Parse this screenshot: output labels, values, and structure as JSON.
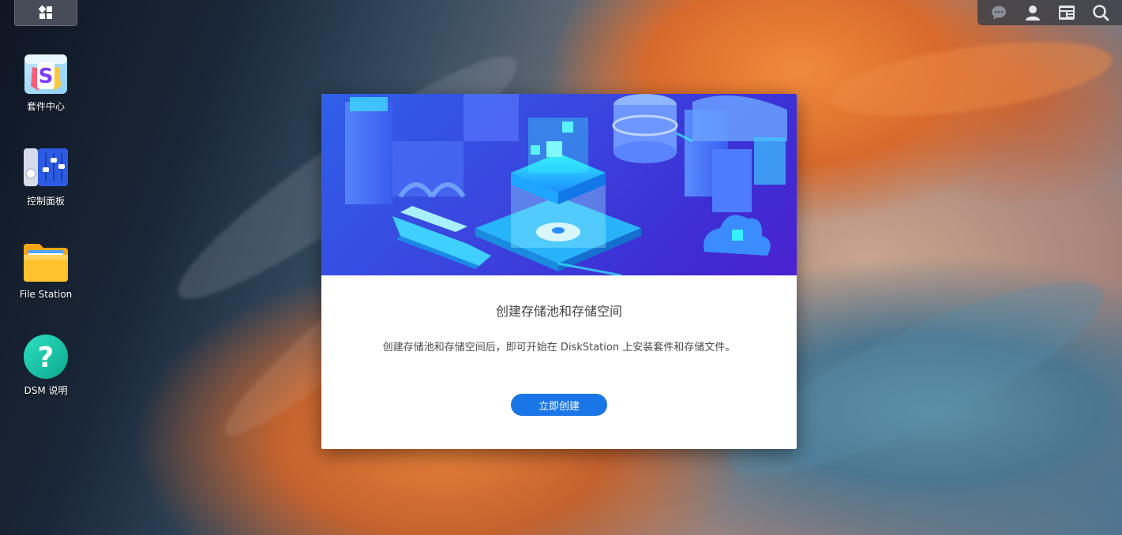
{
  "desktop": {
    "shortcuts": [
      {
        "label": "套件中心",
        "icon": "package-center-icon"
      },
      {
        "label": "控制面板",
        "icon": "control-panel-icon"
      },
      {
        "label": "File Station",
        "icon": "folder-icon"
      },
      {
        "label": "DSM 说明",
        "icon": "help-icon"
      }
    ]
  },
  "taskbar": {
    "main_menu_icon": "main-menu-icon",
    "tray_icons": [
      "notification-icon",
      "user-icon",
      "widgets-icon",
      "search-icon"
    ]
  },
  "dialog": {
    "title": "创建存储池和存储空间",
    "description": "创建存储池和存储空间后，即可开始在 DiskStation 上安装套件和存储文件。",
    "button_label": "立即创建"
  },
  "colors": {
    "accent": "#1a76e6",
    "hero_start": "#2f5fea",
    "hero_end": "#4b21cf"
  }
}
